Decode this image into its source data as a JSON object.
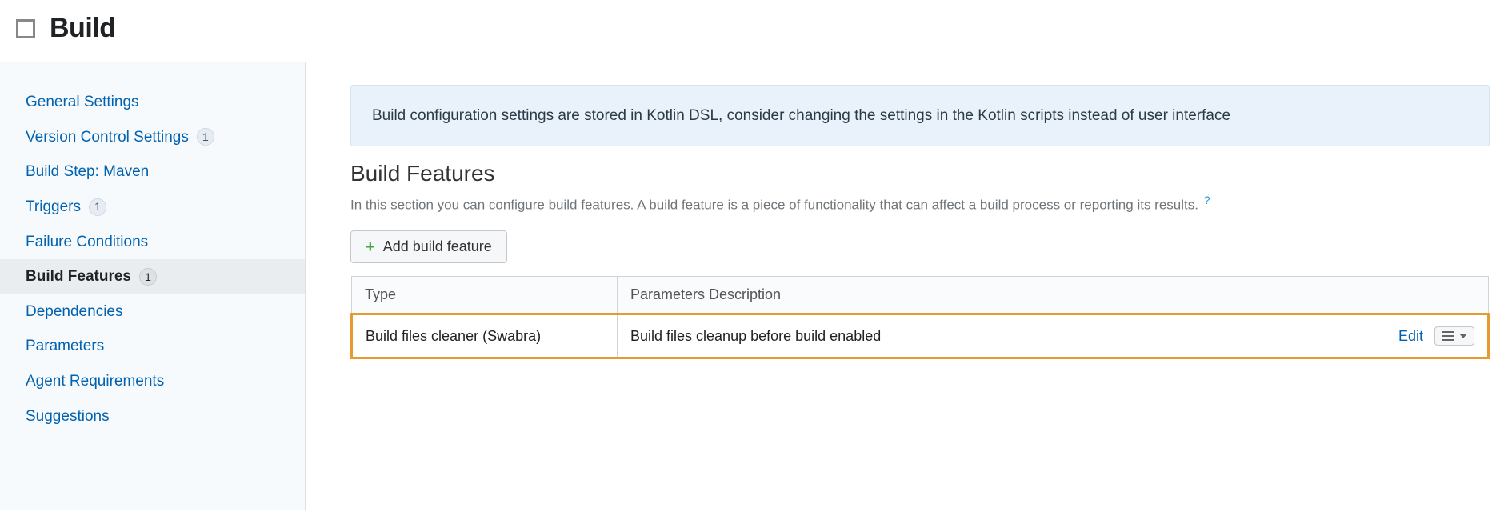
{
  "header": {
    "title": "Build"
  },
  "sidebar": {
    "items": [
      {
        "label": "General Settings",
        "badge": null,
        "active": false
      },
      {
        "label": "Version Control Settings",
        "badge": "1",
        "active": false
      },
      {
        "label": "Build Step: Maven",
        "badge": null,
        "active": false
      },
      {
        "label": "Triggers",
        "badge": "1",
        "active": false
      },
      {
        "label": "Failure Conditions",
        "badge": null,
        "active": false
      },
      {
        "label": "Build Features",
        "badge": "1",
        "active": true
      },
      {
        "label": "Dependencies",
        "badge": null,
        "active": false
      },
      {
        "label": "Parameters",
        "badge": null,
        "active": false
      },
      {
        "label": "Agent Requirements",
        "badge": null,
        "active": false
      },
      {
        "label": "Suggestions",
        "badge": null,
        "active": false
      }
    ]
  },
  "main": {
    "banner": "Build configuration settings are stored in Kotlin DSL, consider changing the settings in the Kotlin scripts instead of user interface",
    "section_title": "Build Features",
    "section_desc": "In this section you can configure build features. A build feature is a piece of functionality that can affect a build process or reporting its results.",
    "help_glyph": "?",
    "add_button_label": "Add build feature",
    "table": {
      "headers": {
        "type": "Type",
        "params": "Parameters Description"
      },
      "rows": [
        {
          "type": "Build files cleaner (Swabra)",
          "params": "Build files cleanup before build enabled",
          "edit_label": "Edit"
        }
      ]
    }
  }
}
